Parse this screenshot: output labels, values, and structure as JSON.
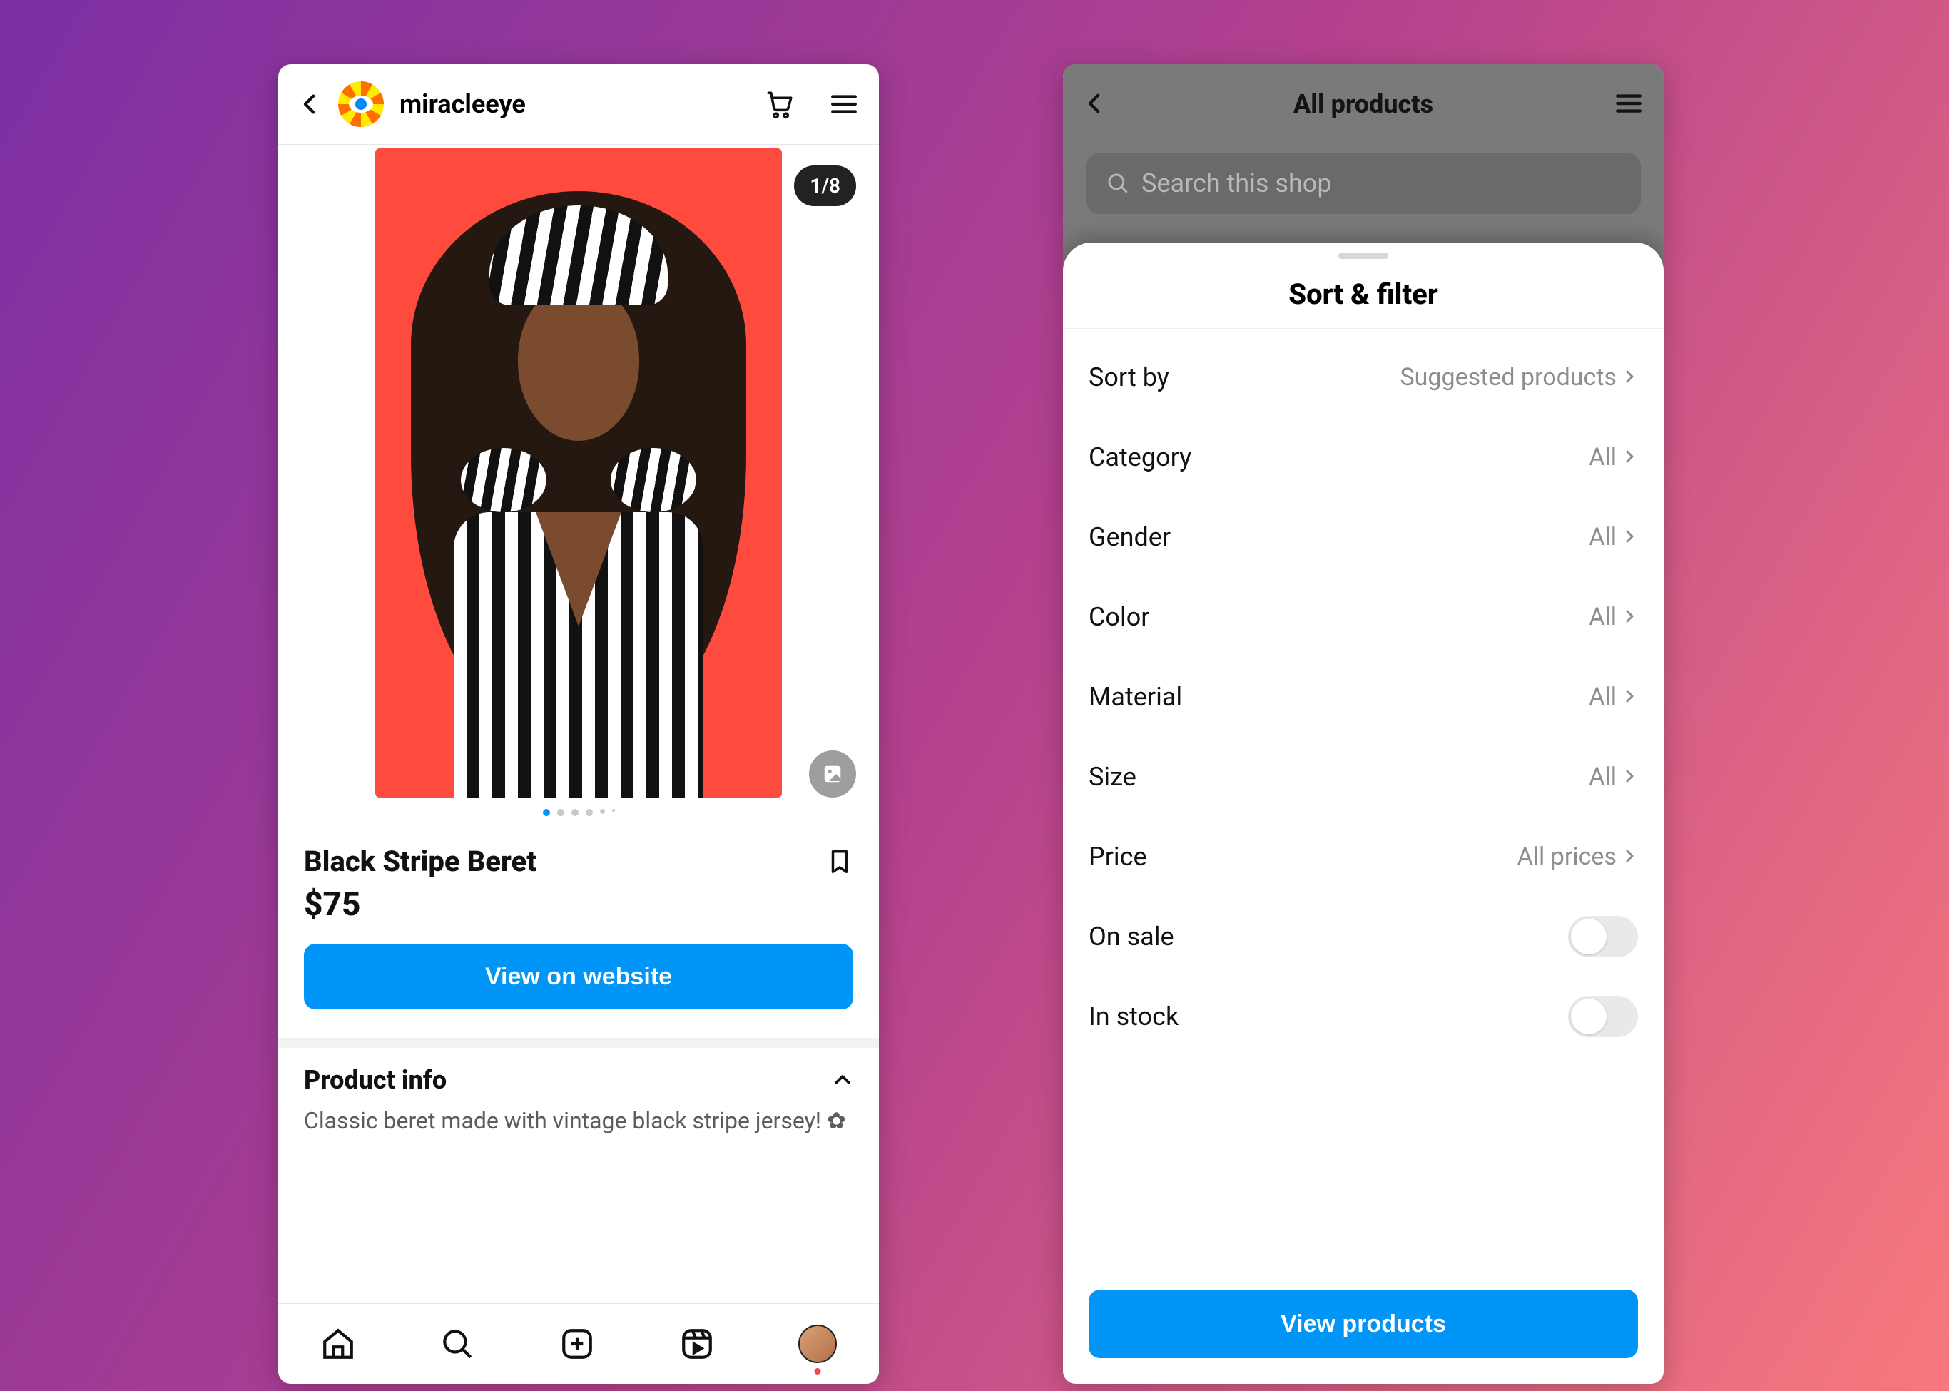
{
  "left": {
    "shop_name": "miracleeye",
    "gallery_counter": "1/8",
    "product_title": "Black Stripe Beret",
    "product_price": "$75",
    "cta": "View on website",
    "info_heading": "Product info",
    "info_body": "Classic beret made with vintage black stripe jersey! ✿"
  },
  "right": {
    "bg_title": "All products",
    "search_placeholder": "Search this shop",
    "sheet_title": "Sort & filter",
    "rows": [
      {
        "label": "Sort by",
        "value": "Suggested products"
      },
      {
        "label": "Category",
        "value": "All"
      },
      {
        "label": "Gender",
        "value": "All"
      },
      {
        "label": "Color",
        "value": "All"
      },
      {
        "label": "Material",
        "value": "All"
      },
      {
        "label": "Size",
        "value": "All"
      },
      {
        "label": "Price",
        "value": "All prices"
      }
    ],
    "toggles": [
      {
        "label": "On sale"
      },
      {
        "label": "In stock"
      }
    ],
    "cta": "View products"
  }
}
